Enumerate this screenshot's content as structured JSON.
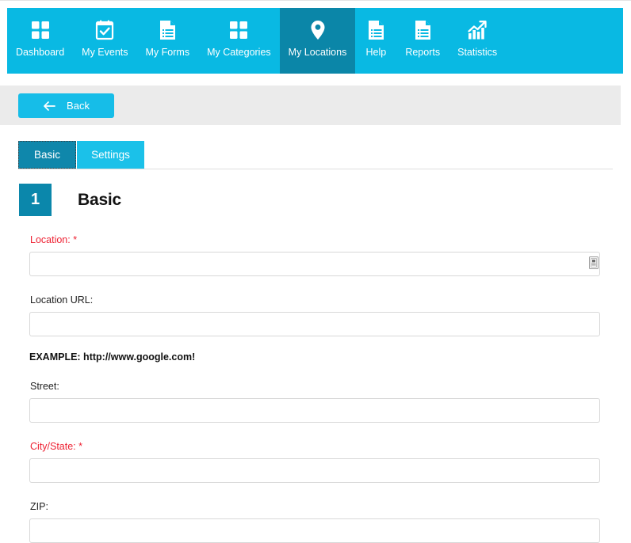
{
  "nav": {
    "items": [
      {
        "label": "Dashboard",
        "icon": "grid-squares-icon",
        "active": false
      },
      {
        "label": "My Events",
        "icon": "calendar-check-icon",
        "active": false
      },
      {
        "label": "My Forms",
        "icon": "document-list-icon",
        "active": false
      },
      {
        "label": "My Categories",
        "icon": "grid-squares-icon",
        "active": false
      },
      {
        "label": "My Locations",
        "icon": "map-pin-icon",
        "active": true
      },
      {
        "label": "Help",
        "icon": "document-list-icon",
        "active": false
      },
      {
        "label": "Reports",
        "icon": "document-list-icon",
        "active": false
      },
      {
        "label": "Statistics",
        "icon": "bar-chart-arrow-icon",
        "active": false
      }
    ],
    "bg_color": "#09b9e3",
    "active_bg_color": "#0b86a8"
  },
  "toolbar": {
    "back_label": "Back",
    "back_icon": "arrow-left-icon",
    "bar_bg_color": "#ebebeb",
    "button_color": "#16bde8"
  },
  "tabs": [
    {
      "label": "Basic",
      "active": true,
      "color": "#0f87ab"
    },
    {
      "label": "Settings",
      "active": false,
      "color": "#1bc1e9"
    }
  ],
  "section": {
    "step_number": "1",
    "title": "Basic",
    "badge_color": "#0b87ab"
  },
  "form": {
    "required_color": "#ee2233",
    "fields": [
      {
        "label": "Location: *",
        "required": true,
        "value": "",
        "placeholder": "",
        "trailing_icon": "autofill-card-icon"
      },
      {
        "label": "Location URL:",
        "required": false,
        "value": "",
        "placeholder": "",
        "trailing_icon": null
      },
      {
        "label": "Street:",
        "required": false,
        "value": "",
        "placeholder": "",
        "trailing_icon": null
      },
      {
        "label": "City/State: *",
        "required": true,
        "value": "",
        "placeholder": "",
        "trailing_icon": null
      },
      {
        "label": "ZIP:",
        "required": false,
        "value": "",
        "placeholder": "",
        "trailing_icon": null
      }
    ],
    "example_note": "EXAMPLE: http://www.google.com!"
  }
}
